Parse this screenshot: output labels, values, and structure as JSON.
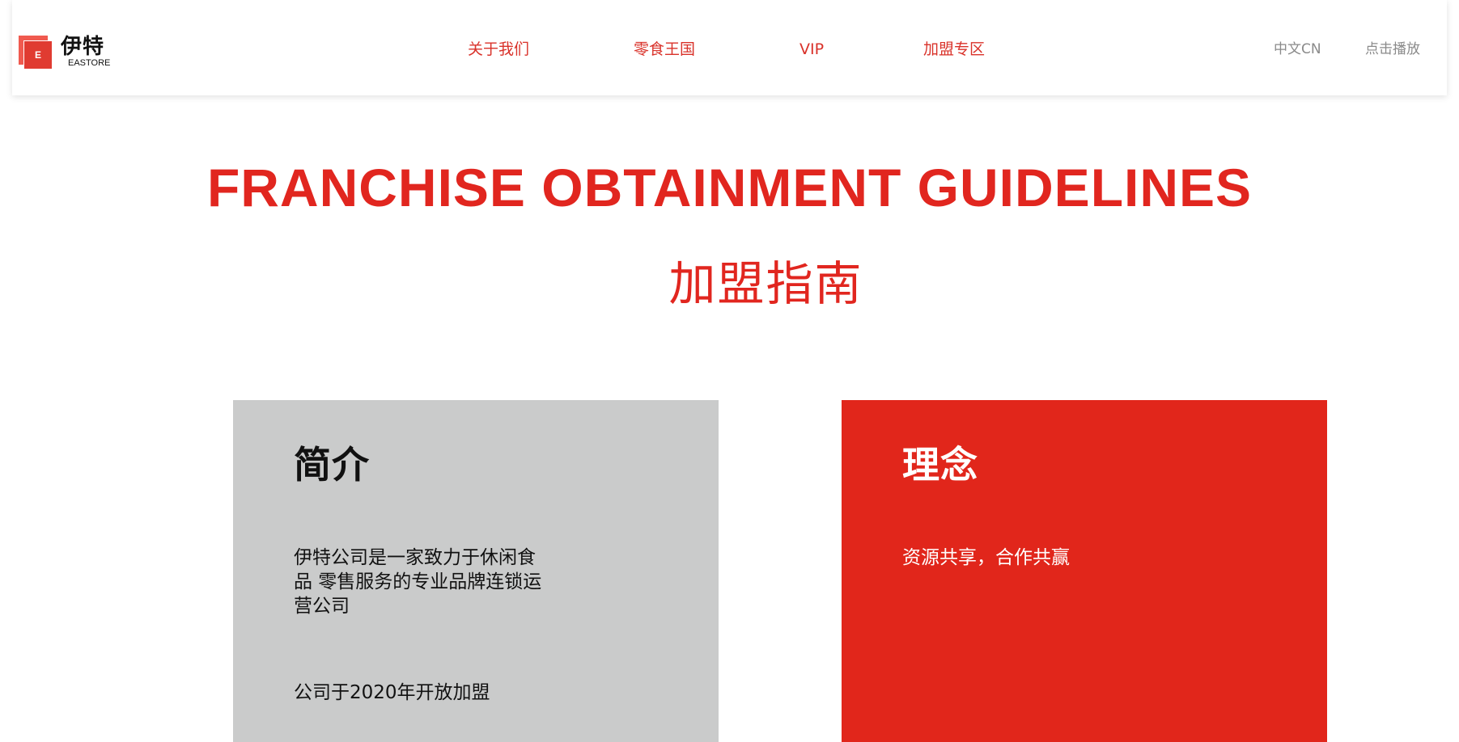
{
  "header": {
    "logo": {
      "mark_letter": "E",
      "name_cn": "伊特",
      "name_en": "EASTORE"
    },
    "nav": [
      {
        "label": "关于我们"
      },
      {
        "label": "零食王国"
      },
      {
        "label": "VIP"
      },
      {
        "label": "加盟专区"
      }
    ],
    "language": "中文CN",
    "play": "点击播放"
  },
  "hero": {
    "title_en": "FRANCHISE OBTAINMENT GUIDELINES",
    "title_cn": "加盟指南"
  },
  "cards": {
    "intro": {
      "title": "简介",
      "paragraph": "伊特公司是一家致力于休闲食品 零售服务的专业品牌连锁运营公司",
      "note": "公司于2020年开放加盟"
    },
    "idea": {
      "title": "理念",
      "paragraph": "资源共享，合作共赢"
    }
  },
  "colors": {
    "brand_red": "#e1261f",
    "nav_red": "#d9322a",
    "gray_card": "#cacbcb",
    "muted_text": "#8a8a8a"
  }
}
